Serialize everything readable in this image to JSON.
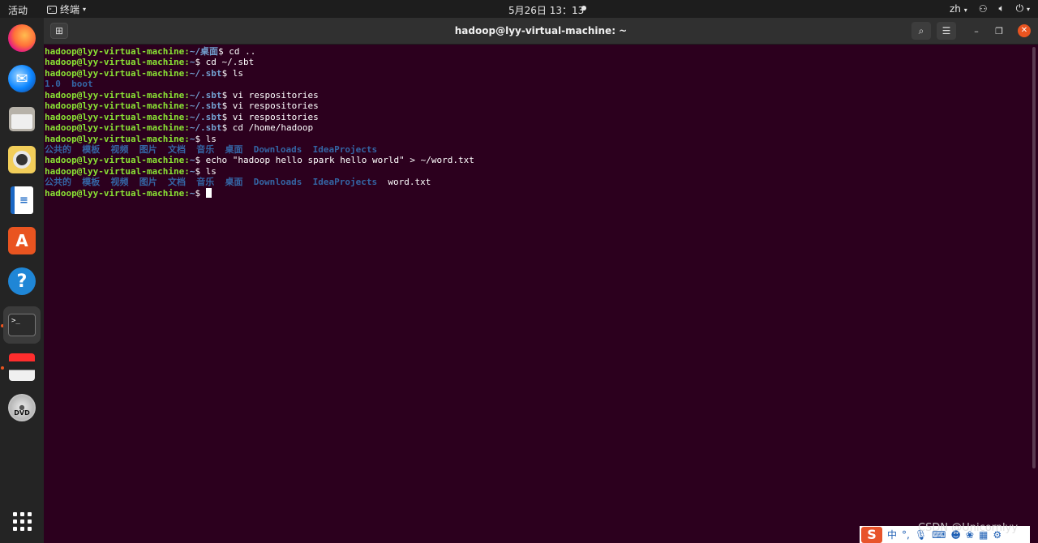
{
  "topbar": {
    "activities": "活动",
    "app_name": "终端",
    "clock": "5月26日 13：13",
    "lang": "zh",
    "caret": "▾"
  },
  "dock": {
    "items": [
      "firefox-icon",
      "thunderbird-icon",
      "files-icon",
      "rhythmbox-icon",
      "writer-icon",
      "software-icon",
      "help-icon",
      "terminal-icon",
      "java-icon",
      "dvd-icon",
      "app-grid-icon"
    ]
  },
  "window": {
    "title": "hadoop@lyy-virtual-machine: ~",
    "new_tab": "⊞"
  },
  "prompt": {
    "user": "hadoop@lyy-virtual-machine",
    "sep": ":"
  },
  "lines": [
    {
      "path": "~/桌面",
      "cmd": "$ cd .."
    },
    {
      "path": "~",
      "cmd": "$ cd ~/.sbt"
    },
    {
      "path": "~/.sbt",
      "cmd": "$ ls"
    },
    {
      "output": [
        {
          "t": "1.0",
          "k": "dir"
        },
        {
          "t": "boot",
          "k": "dir"
        }
      ]
    },
    {
      "path": "~/.sbt",
      "cmd": "$ vi respositories"
    },
    {
      "path": "~/.sbt",
      "cmd": "$ vi respositories"
    },
    {
      "path": "~/.sbt",
      "cmd": "$ vi respositories"
    },
    {
      "path": "~/.sbt",
      "cmd": "$ cd /home/hadoop"
    },
    {
      "path": "~",
      "cmd": "$ ls"
    },
    {
      "output": [
        {
          "t": "公共的",
          "k": "dir"
        },
        {
          "t": "模板",
          "k": "dir"
        },
        {
          "t": "视频",
          "k": "dir"
        },
        {
          "t": "图片",
          "k": "dir"
        },
        {
          "t": "文档",
          "k": "dir"
        },
        {
          "t": "音乐",
          "k": "dir"
        },
        {
          "t": "桌面",
          "k": "dir"
        },
        {
          "t": "Downloads",
          "k": "dir"
        },
        {
          "t": "IdeaProjects",
          "k": "dir"
        }
      ]
    },
    {
      "path": "~",
      "cmd": "$ echo \"hadoop hello spark hello world\" > ~/word.txt"
    },
    {
      "path": "~",
      "cmd": "$ ls"
    },
    {
      "output": [
        {
          "t": "公共的",
          "k": "dir"
        },
        {
          "t": "模板",
          "k": "dir"
        },
        {
          "t": "视频",
          "k": "dir"
        },
        {
          "t": "图片",
          "k": "dir"
        },
        {
          "t": "文档",
          "k": "dir"
        },
        {
          "t": "音乐",
          "k": "dir"
        },
        {
          "t": "桌面",
          "k": "dir"
        },
        {
          "t": "Downloads",
          "k": "dir"
        },
        {
          "t": "IdeaProjects",
          "k": "dir"
        },
        {
          "t": "word.txt",
          "k": "file"
        }
      ]
    },
    {
      "path": "~",
      "cmd": "$ ",
      "cursor": true
    }
  ],
  "ime": {
    "logo": "S",
    "mode": "中",
    "punct": "°,"
  },
  "watermark": "CSDN @Unicornlyy",
  "colors": {
    "terminal_bg": "#2c001e",
    "prompt_user": "#8ae234",
    "prompt_path": "#729fcf",
    "dir": "#3465a4",
    "accent": "#e95420"
  }
}
